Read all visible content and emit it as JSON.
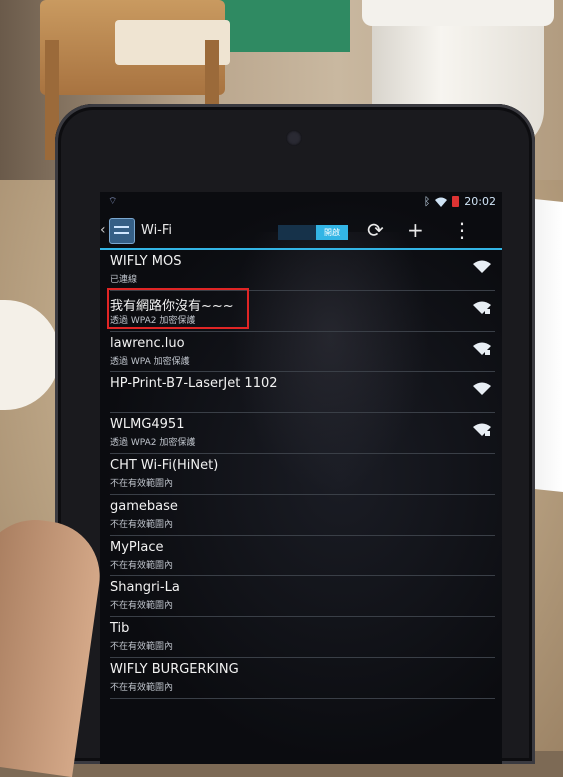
{
  "status_bar": {
    "time": "20:02",
    "bluetooth_icon": "bluetooth-icon",
    "wifi_icon": "wifi-icon",
    "battery_icon": "battery-low-icon",
    "battery_color": "#dd3333"
  },
  "action_bar": {
    "title": "Wi-Fi",
    "toggle_label": "開啟",
    "accent_color": "#33b5e5",
    "buttons": [
      {
        "icon": "wps-icon",
        "glyph": "⟳"
      },
      {
        "icon": "add-network-icon",
        "glyph": "+"
      },
      {
        "icon": "overflow-menu-icon",
        "glyph": "⋮"
      }
    ]
  },
  "networks": [
    {
      "name": "WIFLY MOS",
      "status": "已連線",
      "signal": true,
      "secured": false
    },
    {
      "name": "我有網路你沒有~~~",
      "status": "透過 WPA2 加密保護",
      "signal": true,
      "secured": true,
      "highlighted": true
    },
    {
      "name": "lawrenc.luo",
      "status": "透過 WPA 加密保護",
      "signal": true,
      "secured": true
    },
    {
      "name": "HP-Print-B7-LaserJet 1102",
      "status": "",
      "signal": true,
      "secured": false
    },
    {
      "name": "WLMG4951",
      "status": "透過 WPA2 加密保護",
      "signal": true,
      "secured": true
    },
    {
      "name": "CHT Wi-Fi(HiNet)",
      "status": "不在有效範圍內",
      "signal": false
    },
    {
      "name": "gamebase",
      "status": "不在有效範圍內",
      "signal": false
    },
    {
      "name": "MyPlace",
      "status": "不在有效範圍內",
      "signal": false
    },
    {
      "name": "Shangri-La",
      "status": "不在有效範圍內",
      "signal": false
    },
    {
      "name": "Tib",
      "status": "不在有效範圍內",
      "signal": false
    },
    {
      "name": "WIFLY BURGERKING",
      "status": "不在有效範圍內",
      "signal": false
    }
  ]
}
